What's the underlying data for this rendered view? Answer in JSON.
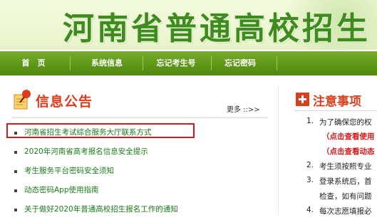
{
  "header": {
    "title": "河南省普通高校招生"
  },
  "nav": {
    "items": [
      "首　页",
      "系统信息",
      "忘记考生号",
      "忘记密码"
    ]
  },
  "notice": {
    "title": "信息公告",
    "more": "更多 ::>>",
    "items": [
      "河南省招生考试综合服务大厅联系方式",
      "2020年河南省高考报名信息安全提示",
      "考生服务平台密码安全须知",
      "动态密码App使用指南",
      "关于做好2020年普通高校招生报名工作的通知"
    ]
  },
  "attention": {
    "title": "注意事项",
    "lines": [
      {
        "num": "1.",
        "text": "为了确保您的权"
      },
      {
        "num": "",
        "text": "（点击查看使用"
      },
      {
        "num": "",
        "text": "（点击查看动态"
      },
      {
        "num": "2.",
        "text": "考生须按照专业"
      },
      {
        "num": "3.",
        "text": "登录系统后，首"
      },
      {
        "num": "",
        "text": "检查，如有问题"
      },
      {
        "num": "4.",
        "text": "每次志愿填报必"
      }
    ]
  },
  "colors": {
    "brand_green": "#3e8c1d",
    "nav_green": "#5f9717",
    "notice_red": "#e03a1a",
    "highlight_red": "#d6191b"
  }
}
